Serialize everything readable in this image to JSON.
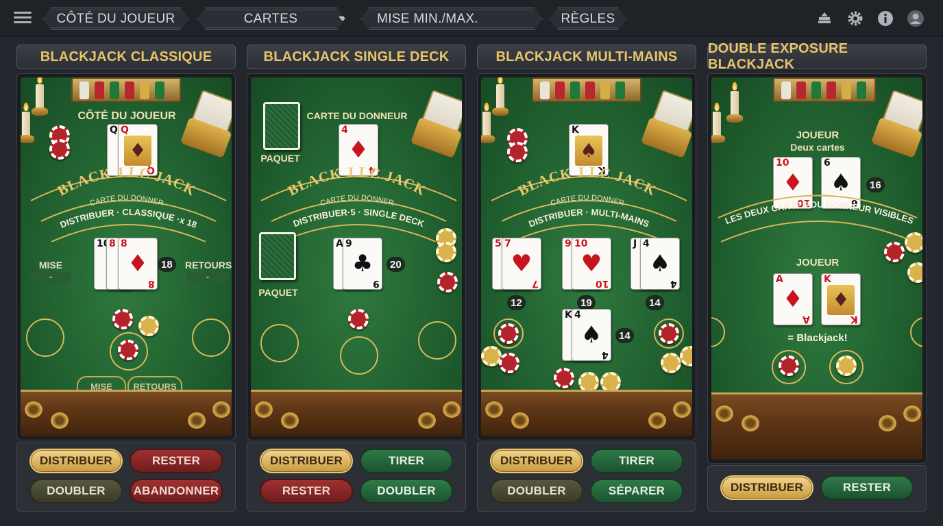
{
  "topbar": {
    "tabs": [
      {
        "label": "CÔTÉ DU JOUEUR"
      },
      {
        "label": "CARTES"
      },
      {
        "label": "MISE MIN./MAX."
      },
      {
        "label": "RÈGLES"
      }
    ],
    "icons": [
      "menu-icon",
      "chip-stack-icon",
      "gear-icon",
      "info-icon",
      "user-icon"
    ]
  },
  "tables": [
    {
      "title": "BLACKJACK CLASSIQUE",
      "top_label": "CÔTÉ DU JOUEUR",
      "dealer_cards": [
        {
          "rank": "Q",
          "suit": "♠",
          "color": "black"
        },
        {
          "rank": "Q",
          "suit": "♦",
          "color": "red",
          "face": true
        }
      ],
      "arc_title": "BLACK J LC JACK",
      "arc_sub": "CARTE DU DONNER",
      "arc_band": "DISTRIBUER · CLASSIQUE ·x 18",
      "player_cards": [
        {
          "rank": "10",
          "suit": "♠",
          "color": "black"
        },
        {
          "rank": "8",
          "suit": "♦",
          "color": "red"
        },
        {
          "rank": "8",
          "suit": "♦",
          "color": "red"
        }
      ],
      "player_total": "18",
      "mise_label": "MISE",
      "mise_value": "-",
      "retours_label": "RETOURS",
      "retours_value": "-",
      "bottom_labels": [
        "MISE",
        "RETOURS"
      ],
      "buttons": [
        {
          "label": "DISTRIBUER",
          "style": "gold"
        },
        {
          "label": "RESTER",
          "style": "red"
        },
        {
          "label": "DOUBLER",
          "style": "olive"
        },
        {
          "label": "ABANDONNER",
          "style": "red"
        }
      ]
    },
    {
      "title": "BLACKJACK SINGLE DECK",
      "deck_label_top": "PAQUET",
      "deck_label_bottom": "PAQUET",
      "top_label": "CARTE DU DONNEUR",
      "dealer_cards": [
        {
          "rank": "4",
          "suit": "♦",
          "color": "red"
        }
      ],
      "arc_title": "BLACK J LC JACK",
      "arc_sub": "CARTE DU DONNER",
      "arc_band": "DISTRIBUER·5 · SINGLE DECK",
      "player_cards": [
        {
          "rank": "A",
          "suit": "♠",
          "color": "black"
        },
        {
          "rank": "9",
          "suit": "♣",
          "color": "black"
        }
      ],
      "player_total": "20",
      "buttons": [
        {
          "label": "DISTRIBUER",
          "style": "gold"
        },
        {
          "label": "TIRER",
          "style": "green"
        },
        {
          "label": "RESTER",
          "style": "red"
        },
        {
          "label": "DOUBLER",
          "style": "green"
        }
      ]
    },
    {
      "title": "BLACKJACK MULTI-MAINS",
      "dealer_cards": [
        {
          "rank": "K",
          "suit": "♠",
          "color": "black",
          "face": true
        }
      ],
      "arc_title": "BLACK J LC JACK",
      "arc_sub": "CARTE DU DONNER",
      "arc_band": "DISTRIBUER · MULTI-MAINS",
      "hands": [
        {
          "cards": [
            {
              "rank": "5",
              "suit": "♥",
              "color": "red"
            },
            {
              "rank": "7",
              "suit": "♥",
              "color": "red"
            }
          ],
          "total": "12"
        },
        {
          "cards": [
            {
              "rank": "9",
              "suit": "♥",
              "color": "red"
            },
            {
              "rank": "10",
              "suit": "♥",
              "color": "red"
            }
          ],
          "total": "19"
        },
        {
          "cards": [
            {
              "rank": "J",
              "suit": "♠",
              "color": "black"
            },
            {
              "rank": "4",
              "suit": "♠",
              "color": "black"
            }
          ],
          "total": "14"
        },
        {
          "cards": [
            {
              "rank": "K",
              "suit": "♠",
              "color": "black"
            },
            {
              "rank": "4",
              "suit": "♠",
              "color": "black"
            }
          ],
          "total": "14"
        }
      ],
      "buttons": [
        {
          "label": "DISTRIBUER",
          "style": "gold"
        },
        {
          "label": "TIRER",
          "style": "green"
        },
        {
          "label": "DOUBLER",
          "style": "olive"
        },
        {
          "label": "SÉPARER",
          "style": "green"
        }
      ]
    },
    {
      "title": "DOUBLE EXPOSURE BLACKJACK",
      "dealer_heading": "JOUEUR",
      "dealer_sub": "Deux cartes",
      "dealer_cards": [
        {
          "rank": "10",
          "suit": "♦",
          "color": "red"
        },
        {
          "rank": "6",
          "suit": "♠",
          "color": "black"
        }
      ],
      "dealer_total": "16",
      "arc_band": "LES DEUX CARTES DU DONNEUR VISIBLES",
      "player_heading": "JOUEUR",
      "player_cards": [
        {
          "rank": "A",
          "suit": "♦",
          "color": "red"
        },
        {
          "rank": "K",
          "suit": "♦",
          "color": "red",
          "face": true
        }
      ],
      "result": "= Blackjack!",
      "buttons": [
        {
          "label": "DISTRIBUER",
          "style": "gold"
        },
        {
          "label": "RESTER",
          "style": "green"
        }
      ]
    }
  ],
  "colors": {
    "felt": "#216130",
    "gold_text": "#e8c46a",
    "rail": "#5e3616",
    "background": "#23262c"
  }
}
